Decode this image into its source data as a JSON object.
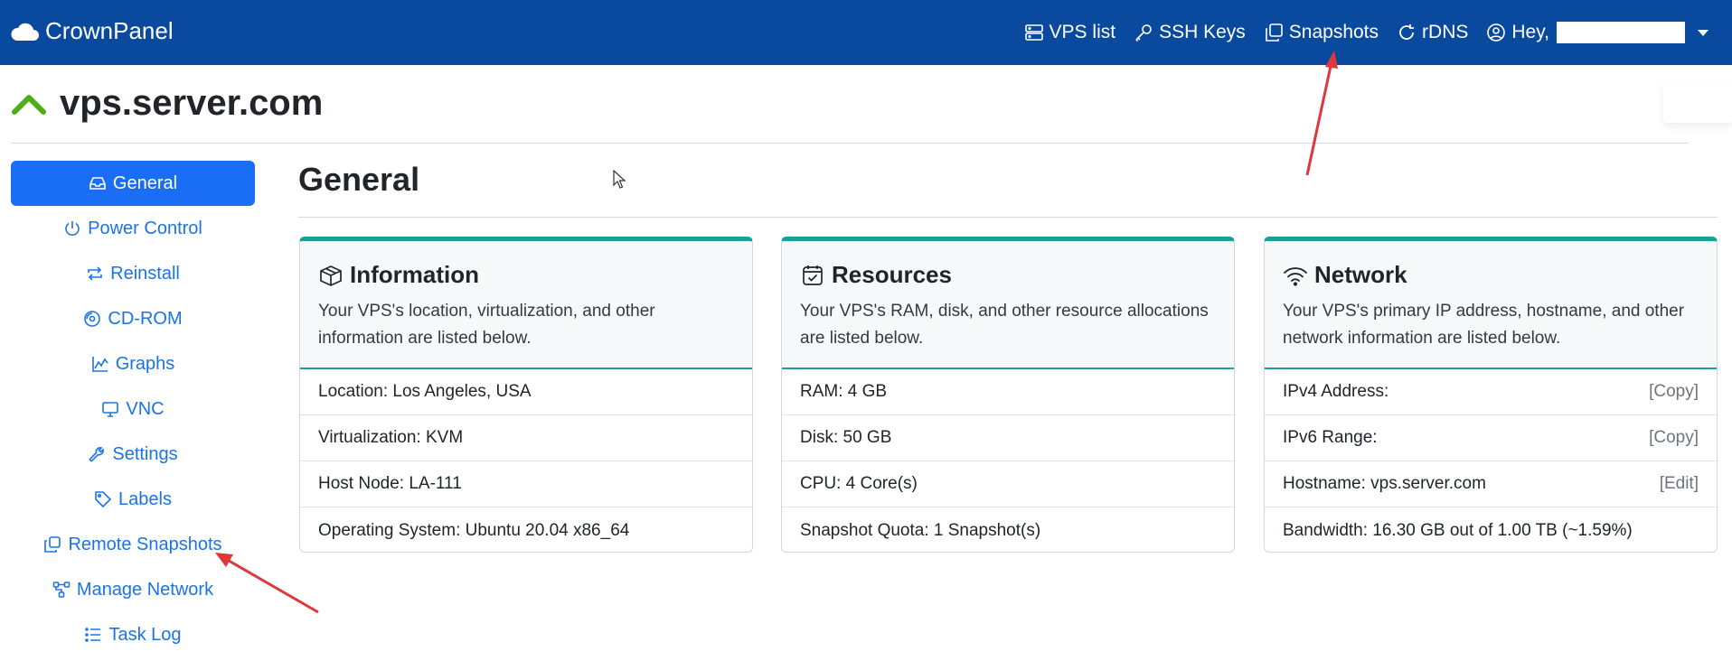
{
  "brand": {
    "name": "CrownPanel",
    "icon": "cloud-icon"
  },
  "nav": [
    {
      "label": "VPS list",
      "icon": "server-icon"
    },
    {
      "label": "SSH Keys",
      "icon": "key-icon"
    },
    {
      "label": "Snapshots",
      "icon": "copy-icon"
    },
    {
      "label": "rDNS",
      "icon": "refresh-icon"
    },
    {
      "label": "Hey,",
      "icon": "user-circle-icon"
    }
  ],
  "server": {
    "hostname": "vps.server.com",
    "status_icon": "chevron-up-icon"
  },
  "sidebar": [
    {
      "label": "General",
      "icon": "inbox-icon",
      "active": true
    },
    {
      "label": "Power Control",
      "icon": "power-icon"
    },
    {
      "label": "Reinstall",
      "icon": "arrows-repeat-icon"
    },
    {
      "label": "CD-ROM",
      "icon": "disc-icon"
    },
    {
      "label": "Graphs",
      "icon": "graph-icon"
    },
    {
      "label": "VNC",
      "icon": "monitor-icon"
    },
    {
      "label": "Settings",
      "icon": "wrench-icon"
    },
    {
      "label": "Labels",
      "icon": "tag-icon"
    },
    {
      "label": "Remote Snapshots",
      "icon": "copy-icon"
    },
    {
      "label": "Manage Network",
      "icon": "diagram-icon"
    },
    {
      "label": "Task Log",
      "icon": "list-icon"
    }
  ],
  "page_title": "General",
  "cards": [
    {
      "title": "Information",
      "icon": "box-seam-icon",
      "description": "Your VPS's location, virtualization, and other information are listed below.",
      "rows": [
        {
          "label": "Location: Los Angeles, USA",
          "action": ""
        },
        {
          "label": "Virtualization: KVM",
          "action": ""
        },
        {
          "label": "Host Node: LA-111",
          "action": ""
        },
        {
          "label": "Operating System: Ubuntu 20.04 x86_64",
          "action": ""
        }
      ]
    },
    {
      "title": "Resources",
      "icon": "calendar-check-icon",
      "description": "Your VPS's RAM, disk, and other resource allocations are listed below.",
      "rows": [
        {
          "label": "RAM: 4 GB",
          "action": ""
        },
        {
          "label": "Disk: 50 GB",
          "action": ""
        },
        {
          "label": "CPU: 4 Core(s)",
          "action": ""
        },
        {
          "label": "Snapshot Quota: 1 Snapshot(s)",
          "action": ""
        }
      ]
    },
    {
      "title": "Network",
      "icon": "wifi-icon",
      "description": "Your VPS's primary IP address, hostname, and other network information are listed below.",
      "rows": [
        {
          "label": "IPv4 Address:",
          "action": "[Copy]"
        },
        {
          "label": "IPv6 Range:",
          "action": "[Copy]"
        },
        {
          "label": "Hostname: vps.server.com",
          "action": "[Edit]"
        },
        {
          "label": "Bandwidth: 16.30 GB out of 1.00 TB (~1.59%)",
          "action": ""
        }
      ]
    }
  ],
  "colors": {
    "topbar": "#0a4a9e",
    "accent": "#1a6ef5",
    "link": "#1a73e8",
    "card_border": "#17a095",
    "status_up": "#4caf1a",
    "annotation": "#e0373b"
  }
}
